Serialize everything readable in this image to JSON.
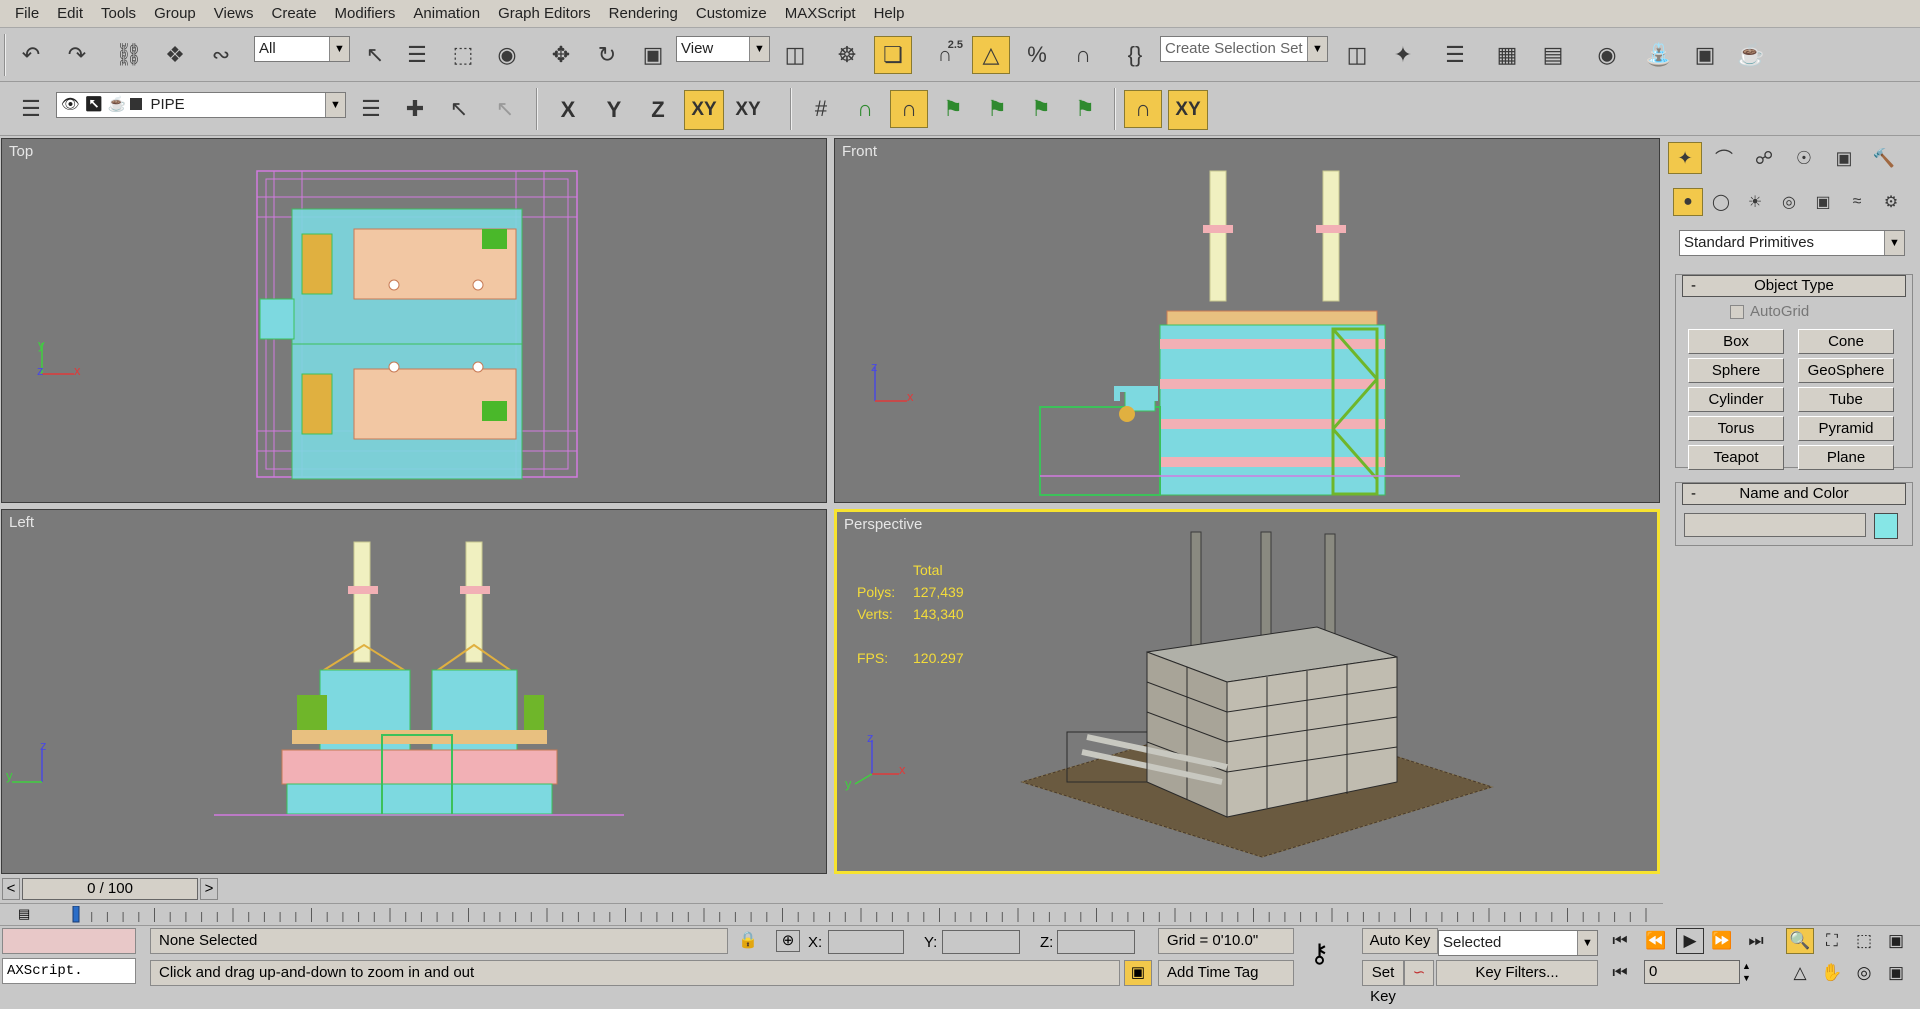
{
  "menu": [
    "File",
    "Edit",
    "Tools",
    "Group",
    "Views",
    "Create",
    "Modifiers",
    "Animation",
    "Graph Editors",
    "Rendering",
    "Customize",
    "MAXScript",
    "Help"
  ],
  "toolbar1": {
    "filter_select": "All",
    "ref_coord_select": "View",
    "snap_value": "2.5",
    "selection_set_placeholder": "Create Selection Set"
  },
  "toolbar2": {
    "layer_name": "PIPE",
    "axis_x": "X",
    "axis_y": "Y",
    "axis_z": "Z",
    "axis_xy": "XY",
    "axis_xy2": "XY",
    "axis_xy3": "XY"
  },
  "viewports": {
    "top": {
      "label": "Top",
      "axis_a": "y",
      "axis_b": "z",
      "axis_c": "x"
    },
    "front": {
      "label": "Front",
      "axis_a": "z",
      "axis_b": "x"
    },
    "left": {
      "label": "Left",
      "axis_a": "z",
      "axis_b": "y"
    },
    "perspective": {
      "label": "Perspective",
      "axis_a": "z",
      "axis_b": "x",
      "axis_c": "y",
      "stats": {
        "header": "Total",
        "polys_label": "Polys:",
        "polys": "127,439",
        "verts_label": "Verts:",
        "verts": "143,340",
        "fps_label": "FPS:",
        "fps": "120.297"
      }
    }
  },
  "command_panel": {
    "category_select": "Standard Primitives",
    "object_type": {
      "title": "Object Type",
      "minus": "-",
      "autogrid": "AutoGrid",
      "buttons": [
        "Box",
        "Cone",
        "Sphere",
        "GeoSphere",
        "Cylinder",
        "Tube",
        "Torus",
        "Pyramid",
        "Teapot",
        "Plane"
      ]
    },
    "name_color": {
      "title": "Name and Color",
      "minus": "-",
      "name_value": "",
      "swatch_color": "#86e6e6"
    }
  },
  "timeline": {
    "frame_display": "0 / 100",
    "prev": "<",
    "next": ">"
  },
  "status": {
    "maxscript_listener": "AXScript.",
    "selection_text": "None Selected",
    "prompt_text": "Click and drag up-and-down to zoom in and out",
    "x_label": "X:",
    "y_label": "Y:",
    "z_label": "Z:",
    "grid_text": "Grid = 0'10.0\"",
    "add_time_tag": "Add Time Tag",
    "auto_key": "Auto Key",
    "set_key": "Set Key",
    "key_mode_select": "Selected",
    "key_filters": "Key Filters...",
    "current_frame": "0"
  },
  "colors": {
    "viewport_bg": "#7a7a7a",
    "active_border": "#f7e32f",
    "stats_text": "#f3dc3a",
    "highlight_button": "#f2c84b"
  }
}
